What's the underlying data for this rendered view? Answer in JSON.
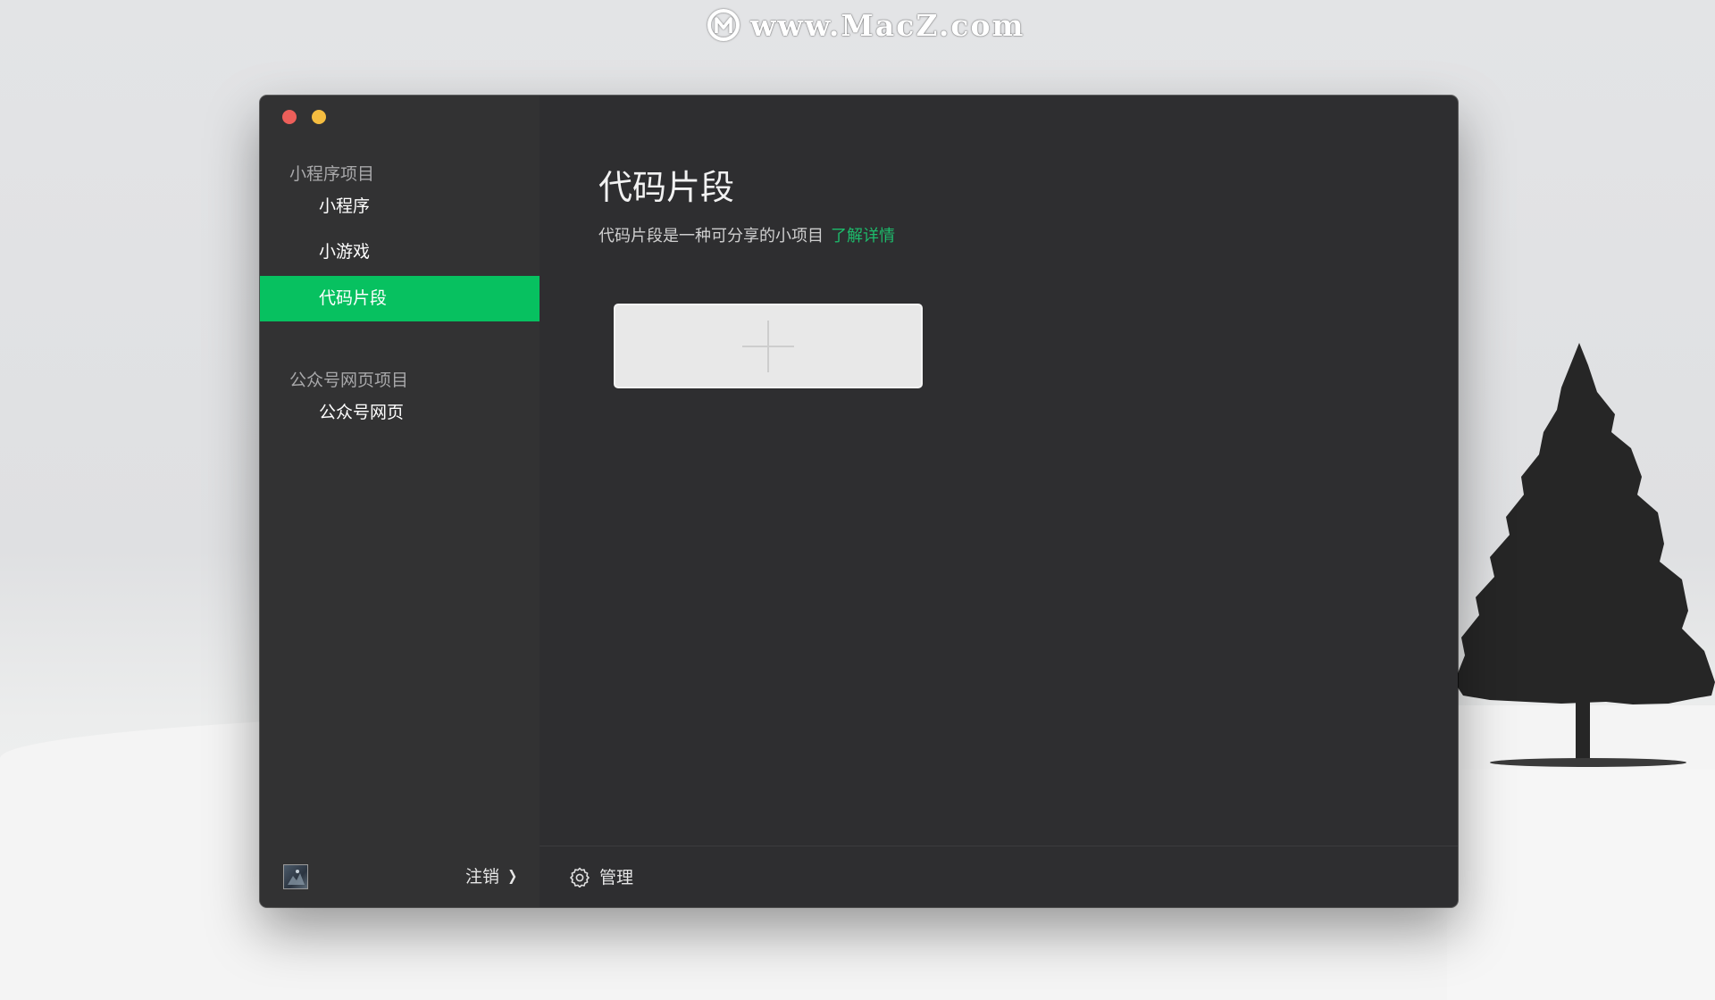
{
  "watermark": {
    "text": "www.MacZ.com"
  },
  "window": {
    "controls": {
      "close_color": "#ed5f5a",
      "minimize_color": "#f5bd40"
    }
  },
  "sidebar": {
    "groups": [
      {
        "title": "小程序项目",
        "items": [
          {
            "label": "小程序",
            "active": false
          },
          {
            "label": "小游戏",
            "active": false
          },
          {
            "label": "代码片段",
            "active": true
          }
        ]
      },
      {
        "title": "公众号网页项目",
        "items": [
          {
            "label": "公众号网页",
            "active": false
          }
        ]
      }
    ],
    "footer": {
      "logout_label": "注销"
    },
    "active_color": "#07c160"
  },
  "main": {
    "title": "代码片段",
    "description": "代码片段是一种可分享的小项目",
    "learn_more": "了解详情",
    "footer": {
      "manage_label": "管理"
    },
    "link_color": "#1dbb6b"
  }
}
